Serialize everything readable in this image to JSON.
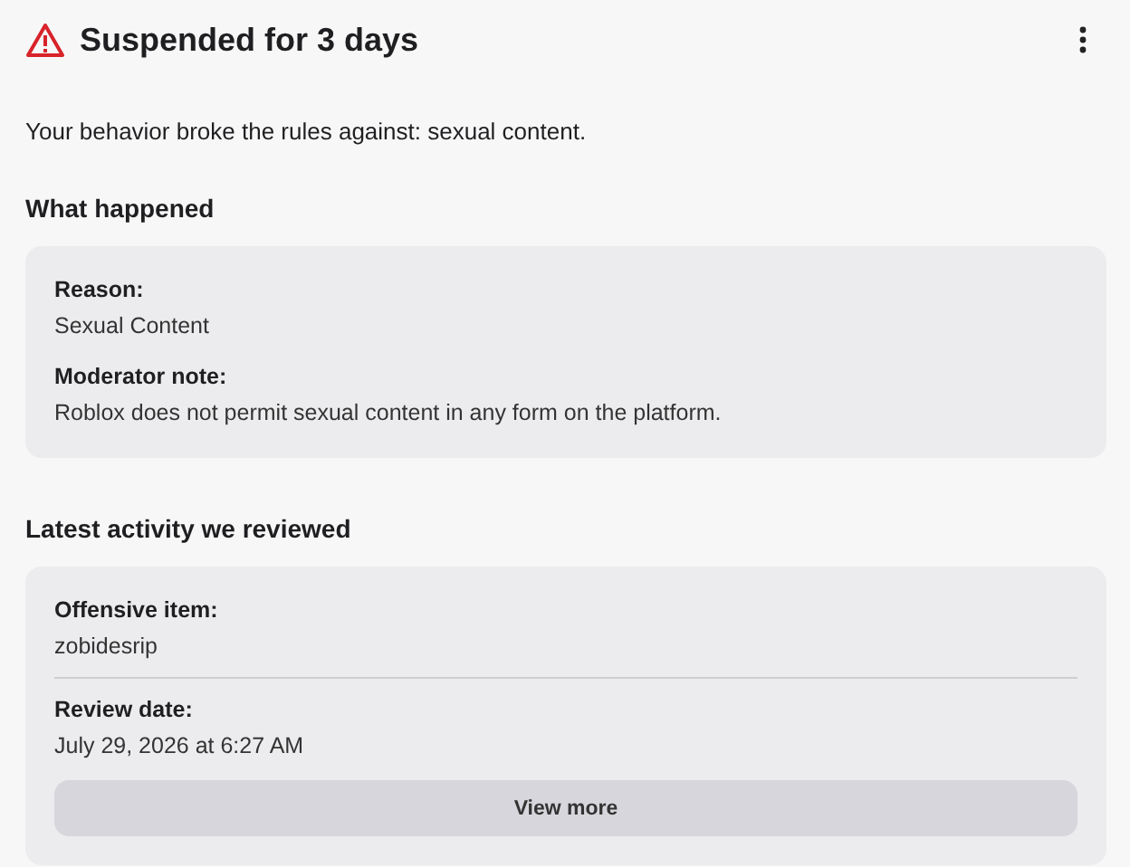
{
  "header": {
    "title": "Suspended for 3 days"
  },
  "description": "Your behavior broke the rules against: sexual content.",
  "sections": [
    {
      "heading": "What happened",
      "fields": [
        {
          "label": "Reason:",
          "value": "Sexual Content"
        },
        {
          "label": "Moderator note:",
          "value": "Roblox does not permit sexual content in any form on the platform."
        }
      ],
      "divided": false
    },
    {
      "heading": "Latest activity we reviewed",
      "fields": [
        {
          "label": "Offensive item:",
          "value": "zobidesrip"
        },
        {
          "label": "Review date:",
          "value": "July 29, 2026 at 6:27 AM"
        }
      ],
      "divided": true,
      "button": "View more"
    }
  ]
}
